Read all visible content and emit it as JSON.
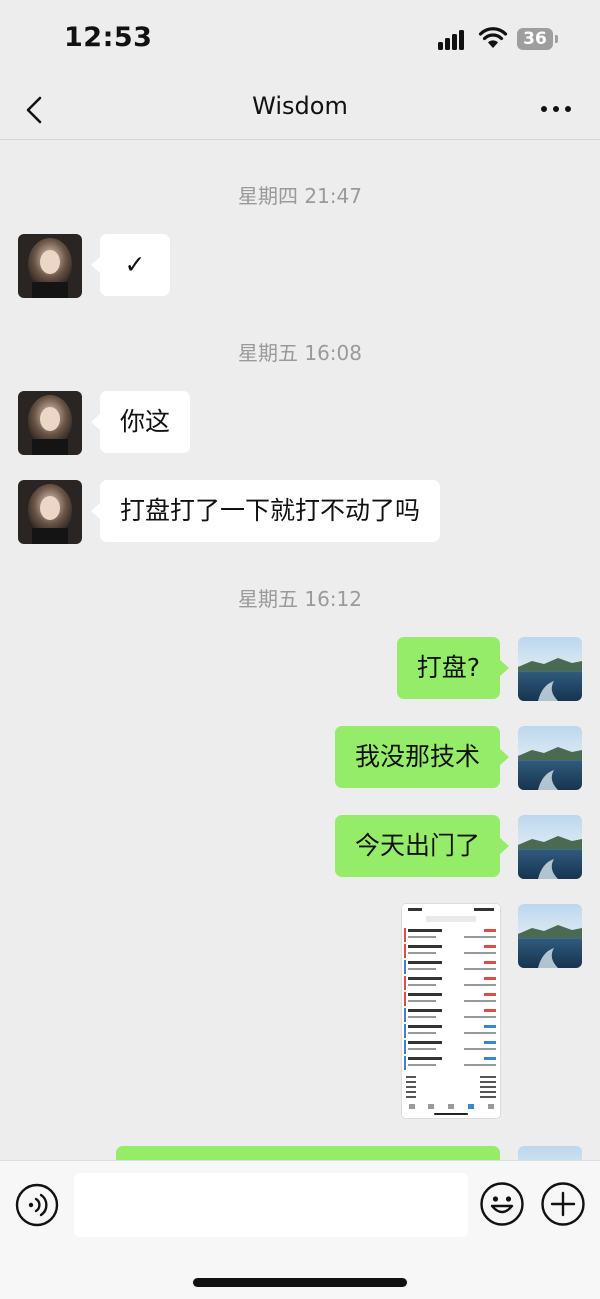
{
  "status_bar": {
    "time": "12:53",
    "battery": "36"
  },
  "nav": {
    "title": "Wisdom"
  },
  "timestamps": [
    "星期四 21:47",
    "星期五 16:08",
    "星期五 16:12"
  ],
  "messages": [
    {
      "side": "left",
      "text": "✓"
    },
    {
      "side": "left",
      "text": "你这"
    },
    {
      "side": "left",
      "text": "打盘打了一下就打不动了吗"
    },
    {
      "side": "right",
      "text": "打盘?"
    },
    {
      "side": "right",
      "text": "我没那技术"
    },
    {
      "side": "right",
      "text": "今天出门了"
    },
    {
      "side": "right",
      "type": "image",
      "description": "screenshot"
    }
  ],
  "colors": {
    "background": "#ededed",
    "sent_bubble": "#95ec69",
    "received_bubble": "#ffffff",
    "timestamp": "#9a9a9a"
  }
}
